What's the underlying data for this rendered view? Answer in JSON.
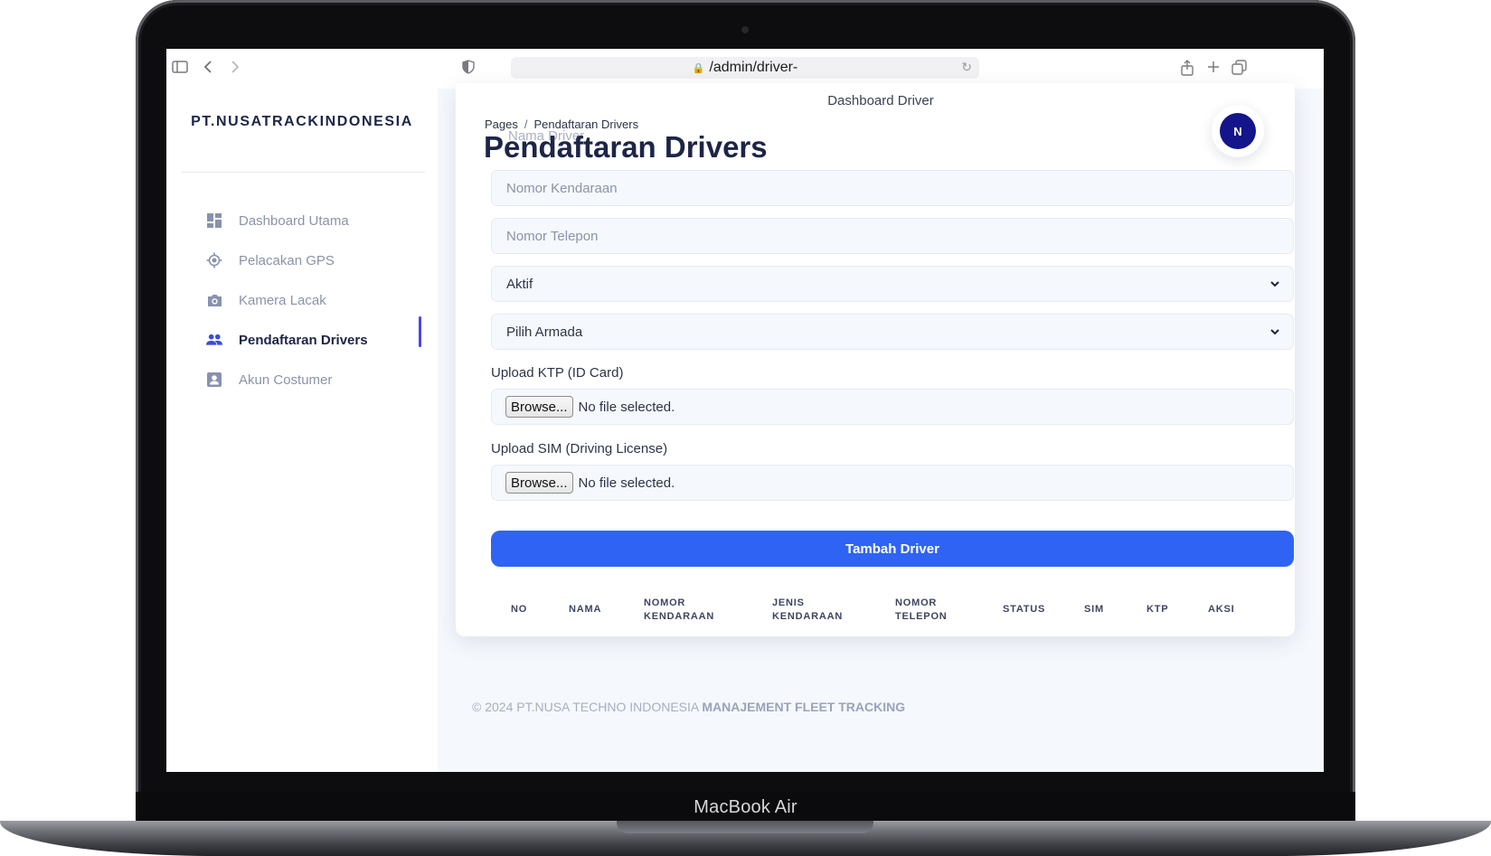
{
  "device": {
    "label": "MacBook Air"
  },
  "browser": {
    "url": "/admin/driver-"
  },
  "sidebar": {
    "brand": "PT.NUSATRACKINDONESIA",
    "items": [
      {
        "label": "Dashboard Utama",
        "icon": "dashboard-icon",
        "active": false
      },
      {
        "label": "Pelacakan GPS",
        "icon": "gps-icon",
        "active": false
      },
      {
        "label": "Kamera Lacak",
        "icon": "camera-icon",
        "active": false
      },
      {
        "label": "Pendaftaran Drivers",
        "icon": "users-icon",
        "active": true
      },
      {
        "label": "Akun Costumer",
        "icon": "account-icon",
        "active": false
      }
    ]
  },
  "header": {
    "heading": "Dashboard Driver",
    "breadcrumb": {
      "root": "Pages",
      "separator": "/",
      "current": "Pendaftaran Drivers"
    },
    "title": "Pendaftaran Drivers",
    "avatar_initial": "N"
  },
  "form": {
    "name_placeholder": "Nama Driver",
    "vehicle_placeholder": "Nomor Kendaraan",
    "phone_placeholder": "Nomor Telepon",
    "status_select": "Aktif",
    "fleet_select": "Pilih Armada",
    "ktp_label": "Upload KTP (ID Card)",
    "sim_label": "Upload SIM (Driving License)",
    "browse_label": "Browse...",
    "no_file": "No file selected.",
    "submit_label": "Tambah Driver"
  },
  "table": {
    "headers": [
      "NO",
      "NAMA",
      "NOMOR KENDARAAN",
      "JENIS KENDARAAN",
      "NOMOR TELEPON",
      "STATUS",
      "SIM",
      "KTP",
      "AKSI"
    ]
  },
  "footer": {
    "copyright": "© 2024 PT.NUSA TECHNO INDONESIA",
    "tagline": "MANAJEMENT FLEET TRACKING"
  },
  "colors": {
    "accent": "#2f63f4",
    "brand": "#1d2547",
    "avatar": "#14158a",
    "active_indicator": "#4b45e6"
  }
}
